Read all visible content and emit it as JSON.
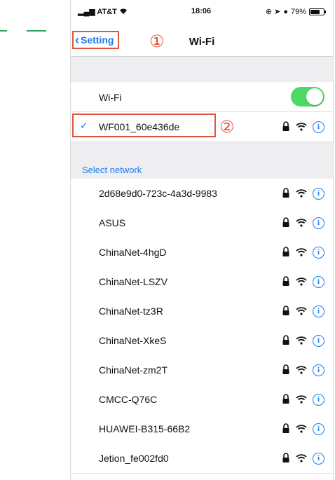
{
  "status_bar": {
    "carrier": "AT&T",
    "time": "18:06",
    "battery_percent": "79%",
    "battery_level": 0.79
  },
  "nav": {
    "back_label": "Setting",
    "title": "Wi-Fi",
    "annotation_1": "①"
  },
  "wifi_toggle": {
    "label": "Wi-Fi",
    "on": true
  },
  "connected": {
    "ssid": "WF001_60e436de",
    "annotation_2": "②"
  },
  "section": {
    "header": "Select network"
  },
  "networks": [
    {
      "ssid": "2d68e9d0-723c-4a3d-9983"
    },
    {
      "ssid": "ASUS"
    },
    {
      "ssid": "ChinaNet-4hgD"
    },
    {
      "ssid": "ChinaNet-LSZV"
    },
    {
      "ssid": "ChinaNet-tz3R"
    },
    {
      "ssid": "ChinaNet-XkeS"
    },
    {
      "ssid": "ChinaNet-zm2T"
    },
    {
      "ssid": "CMCC-Q76C"
    },
    {
      "ssid": "HUAWEI-B315-66B2"
    },
    {
      "ssid": "Jetion_fe002fd0"
    }
  ],
  "colors": {
    "accent": "#1e7cf0",
    "toggle_on": "#4cd964",
    "annotation": "#e0553d",
    "guide": "#2aa55a"
  }
}
